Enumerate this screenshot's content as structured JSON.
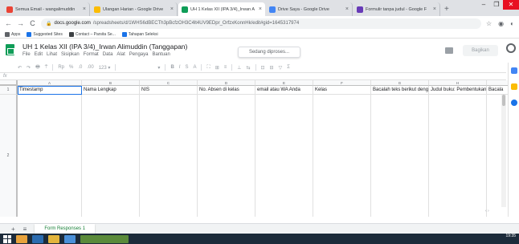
{
  "browser": {
    "tabs": [
      {
        "title": "Semua Email - wangalimuddin",
        "favicon_color": "#ea4335",
        "active": false
      },
      {
        "title": "Ulangan Harian - Google Drive",
        "favicon_color": "#fbbc04",
        "active": false
      },
      {
        "title": "UH 1 Kelas XII (IPA 3/4)_Irwan A",
        "favicon_color": "#0f9d58",
        "active": true
      },
      {
        "title": "Drive Saya - Google Drive",
        "favicon_color": "#4285f4",
        "active": false
      },
      {
        "title": "Formulir tanpa judul - Google F",
        "favicon_color": "#673ab7",
        "active": false
      }
    ],
    "new_tab_label": "+",
    "url_host": "docs.google.com",
    "url_path": "/spreadsheets/d/1WHS6dBECTh3pBcfzOH3C4lt4UV9EDpr_OrfzxKonnHk/edit#gid=1645317974",
    "bookmarks": [
      {
        "label": "Apps",
        "color": "#5f6368"
      },
      {
        "label": "Suggested Sites",
        "color": "#1a73e8"
      },
      {
        "label": "Contact – Parsita Se...",
        "color": "#3c4043"
      },
      {
        "label": "Tahapan Seleksi",
        "color": "#1a73e8"
      }
    ]
  },
  "sheets": {
    "doc_title": "UH 1 Kelas XII (IPA 3/4)_Irwan Alimuddin (Tanggapan)",
    "menu": [
      "File",
      "Edit",
      "Lihat",
      "Sisipkan",
      "Format",
      "Data",
      "Alat",
      "Pengaya",
      "Bantuan"
    ],
    "status": "Sedang diproses...",
    "share_label": "Bagikan",
    "toolbar_items": [
      "↶",
      "↷",
      "🖶",
      "⍑",
      "Rp",
      "%",
      ".0",
      ".00",
      "123 ▾",
      "▾",
      "B",
      "I",
      "S",
      "A",
      "⛶",
      "⊞",
      "≡",
      "⊥",
      "⇆",
      "⊡",
      "⊟",
      "▽",
      "Σ"
    ],
    "fx_label": "fx",
    "columns": [
      "A",
      "B",
      "C",
      "D",
      "E",
      "F",
      "G",
      "H"
    ],
    "row1_label": "1",
    "row2_label": "2",
    "header_cells": [
      "Timestamp",
      "Nama Lengkap",
      "NIS",
      "No. Absen di kelas",
      "email atau WA Anda",
      "Kelas",
      "Bacalah teks berikut deng",
      "Judul buku: Pembentukan",
      "Bacala"
    ],
    "scroll_control": "‹ ›",
    "sheet_add": "+",
    "sheet_list": "≡",
    "sheet_tab": "Form Responses 1"
  },
  "taskbar": {
    "time": "19:35",
    "date": ""
  }
}
